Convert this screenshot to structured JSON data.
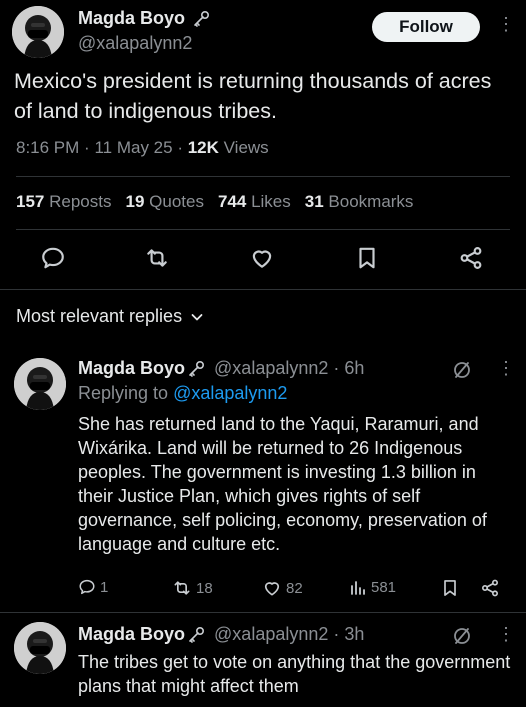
{
  "post": {
    "author_name": "Magda Boyo",
    "author_handle": "@xalapalynn2",
    "follow_label": "Follow",
    "kebab_label": "⋮",
    "text": "Mexico's president is returning thousands of acres of land to indigenous tribes.",
    "time": "8:16 PM",
    "date": "11 May 25",
    "views_count": "12K",
    "views_label": "Views",
    "dot": "·",
    "reposts_count": "157",
    "reposts_label": "Reposts",
    "quotes_count": "19",
    "quotes_label": "Quotes",
    "likes_count": "744",
    "likes_label": "Likes",
    "bookmarks_count": "31",
    "bookmarks_label": "Bookmarks"
  },
  "replies_header": {
    "label": "Most relevant replies"
  },
  "replies": [
    {
      "author_name": "Magda Boyo",
      "author_handle": "@xalapalynn2",
      "age": "6h",
      "replying_label": "Replying to",
      "replying_to": "@xalapalynn2",
      "text": "She has returned land to the Yaqui, Raramuri, and Wixárika. Land will be returned to 26 Indigenous peoples. The government is investing 1.3 billion in their Justice Plan, which gives rights of self governance, self policing, economy, preservation of language and culture etc.",
      "reply_count": "1",
      "repost_count": "18",
      "like_count": "82",
      "view_count": "581"
    },
    {
      "author_name": "Magda Boyo",
      "author_handle": "@xalapalynn2",
      "age": "3h",
      "text": "The tribes get to vote on anything that the government plans that might affect them"
    }
  ],
  "colors": {
    "background": "#000000",
    "text": "#e7e9ea",
    "muted": "#8b8f94",
    "link": "#1d9bf0",
    "divider": "#2f3336"
  },
  "icons": {
    "verified": "key-badge-icon",
    "reply": "speech-bubble-icon",
    "repost": "repost-arrows-icon",
    "like": "heart-icon",
    "bookmark": "bookmark-icon",
    "share": "share-nodes-icon",
    "grok": "slashed-circle-icon",
    "views": "bar-chart-icon",
    "dropdown": "chevron-down-icon"
  }
}
